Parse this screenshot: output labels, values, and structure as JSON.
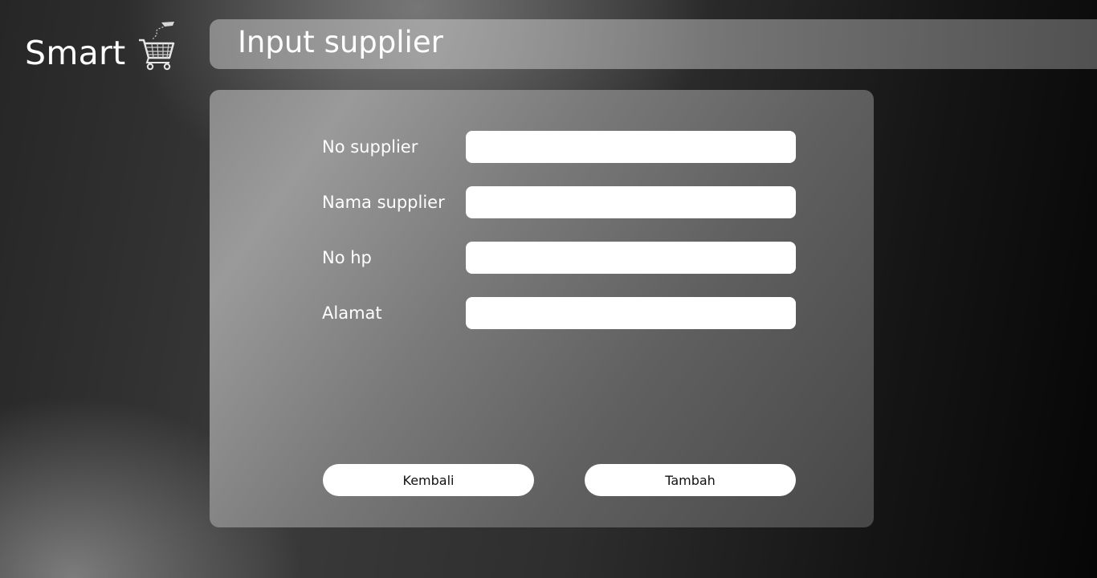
{
  "app": {
    "logo_text": "Smart",
    "logo_icon": "shopping-cart-icon",
    "page_title": "Input supplier"
  },
  "form": {
    "fields": [
      {
        "label": "No supplier",
        "value": "",
        "placeholder": ""
      },
      {
        "label": "Nama supplier",
        "value": "",
        "placeholder": ""
      },
      {
        "label": "No hp",
        "value": "",
        "placeholder": ""
      },
      {
        "label": "Alamat",
        "value": "",
        "placeholder": ""
      }
    ],
    "buttons": {
      "back_label": "Kembali",
      "add_label": "Tambah"
    }
  }
}
